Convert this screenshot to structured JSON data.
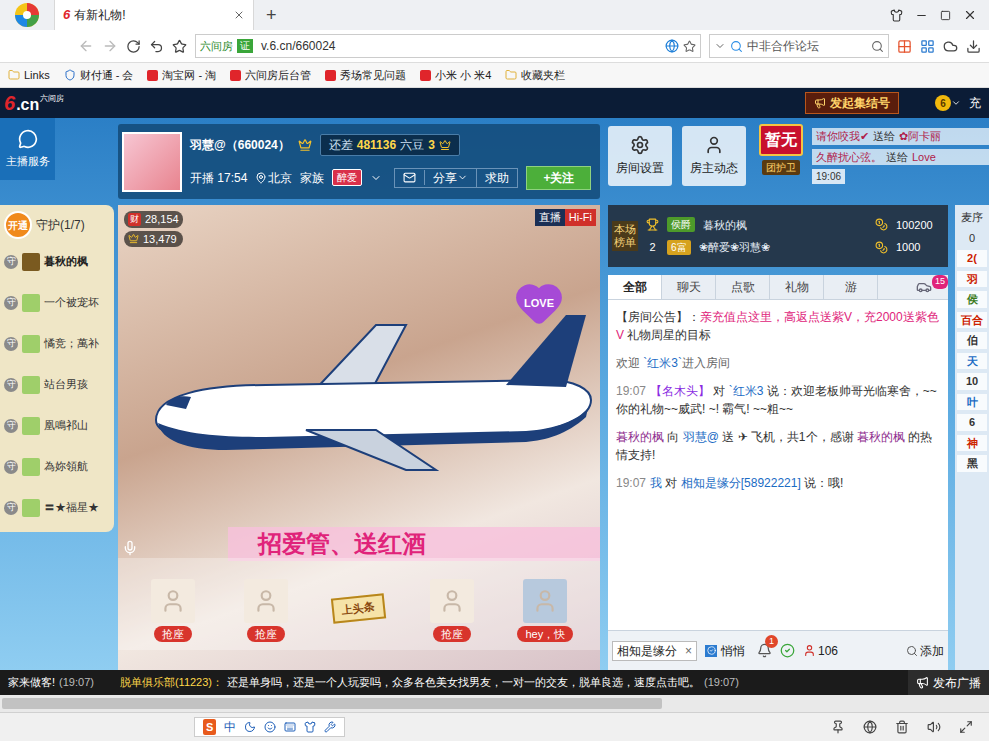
{
  "browser": {
    "tab_title": "有新礼物!",
    "new_tab": "+",
    "site_badge": "六间房",
    "cert": "证",
    "url": "v.6.cn/660024",
    "search_placeholder": "中非合作论坛"
  },
  "bookmarks": [
    "Links",
    "财付通 - 会",
    "淘宝网 - 淘",
    "六间房后台管",
    "秀场常见问题",
    "小米 小 米4",
    "收藏夹栏"
  ],
  "site_header": {
    "logo_mark": "6",
    "logo_text": ".cn",
    "logo_sub": "六间房",
    "rally_button": "发起集结号",
    "coin": "6",
    "recharge": "充"
  },
  "host_service": "主播服务",
  "host": {
    "name": "羽慧@（660024）",
    "need_label": "还差",
    "need_value": "481136",
    "need_unit": "六豆",
    "level": "3",
    "live_label": "开播 17:54",
    "city": "北京",
    "family_label": "家族",
    "family": "醉爱",
    "share": "分享",
    "help": "求助",
    "follow": "+关注"
  },
  "room_buttons": [
    {
      "label": "房间设置"
    },
    {
      "label": "房主动态"
    }
  ],
  "guard": {
    "empty": "暂无",
    "label": "团护卫"
  },
  "feed": {
    "time": "19:06",
    "items": [
      {
        "sender": "请你咬我✔",
        "action": "送给",
        "receiver": "✿阿卡丽"
      },
      {
        "sender": "久醉扰心弦。",
        "action": "送给",
        "receiver": "Love"
      }
    ]
  },
  "guardians": {
    "open": "开通",
    "title": "守护(1/7)",
    "badge": "守",
    "items": [
      {
        "name": "暮秋的枫",
        "selected": true
      },
      {
        "name": "一个被宠坏",
        "selected": false
      },
      {
        "name": "憰竞；萬补",
        "selected": false
      },
      {
        "name": "站台男孩",
        "selected": false
      },
      {
        "name": "凰鳴祁山",
        "selected": false
      },
      {
        "name": "為妳領航",
        "selected": false
      },
      {
        "name": "〓★福星★",
        "selected": false
      }
    ]
  },
  "video": {
    "wealth_icon": "财",
    "wealth": "28,154",
    "fans": "13,479",
    "live_tag": "直播",
    "hifi": "Hi-Fi",
    "love": "LOVE",
    "banner": "招爱管、送红酒",
    "seats": [
      {
        "label": "抢座",
        "kind": "seat"
      },
      {
        "label": "抢座",
        "kind": "seat"
      },
      {
        "label": "上头条",
        "kind": "headline"
      },
      {
        "label": "抢座",
        "kind": "seat"
      },
      {
        "label": "hey，快",
        "kind": "taken"
      }
    ]
  },
  "ranking": {
    "title": "本场榜单",
    "rows": [
      {
        "rank": "1",
        "kind": "trophy",
        "badge": "侯爵",
        "name": "暮秋的枫",
        "score": "100200"
      },
      {
        "rank": "2",
        "kind": "number",
        "badge": "6富",
        "name": "❀醉爱❀羽慧❀",
        "score": "1000"
      }
    ]
  },
  "chat": {
    "tabs": [
      {
        "label": "全部",
        "selected": true
      },
      {
        "label": "聊天",
        "selected": false
      },
      {
        "label": "点歌",
        "selected": false
      },
      {
        "label": "礼物",
        "selected": false
      },
      {
        "label": "游",
        "selected": false
      }
    ],
    "car_badge": "15",
    "messages": [
      {
        "time": "",
        "parts": [
          {
            "text": "【房间公告】：",
            "color": "#333333"
          },
          {
            "text": "亲充值点这里，高返点",
            "color": "#e0237a"
          },
          {
            "text": "送紫V，充2000送紫色V",
            "color": "#e0237a"
          },
          {
            "text": " 礼物周星的目标",
            "color": "#333333"
          }
        ]
      },
      {
        "time": "",
        "parts": [
          {
            "text": "欢迎 ",
            "color": "#666666"
          },
          {
            "text": "`红米3`",
            "color": "#1a6bc4"
          },
          {
            "text": "进入房间",
            "color": "#666666"
          }
        ]
      },
      {
        "time": "19:07",
        "parts": [
          {
            "text": "【名木头】",
            "color": "#8a2be2"
          },
          {
            "text": " 对 ",
            "color": "#333333"
          },
          {
            "text": "`红米3",
            "color": "#1a6bc4"
          },
          {
            "text": " 说：欢迎老板帅哥光临寒舍，~~你的礼物~~威武! ~! 霸气! ~~粗~~",
            "color": "#333333"
          }
        ]
      },
      {
        "time": "",
        "parts": [
          {
            "text": "暮秋的枫",
            "color": "#8e2d8e"
          },
          {
            "text": " 向 ",
            "color": "#333333"
          },
          {
            "text": "羽慧@",
            "color": "#1a6bc4"
          },
          {
            "text": " 送 ✈ 飞机，共1个，感谢 ",
            "color": "#333333"
          },
          {
            "text": "暮秋的枫",
            "color": "#8e2d8e"
          },
          {
            "text": " 的热情支持!",
            "color": "#333333"
          }
        ]
      },
      {
        "time": "19:07",
        "parts": [
          {
            "text": "我",
            "color": "#1a6bc4"
          },
          {
            "text": " 对 ",
            "color": "#333333"
          },
          {
            "text": "相知是缘分[58922221]",
            "color": "#1a6bc4"
          },
          {
            "text": " 说：哦!",
            "color": "#333333"
          }
        ]
      }
    ]
  },
  "input": {
    "target": "相知是缘分",
    "close": "×",
    "whisper": {
      "label": "悄悄",
      "checked": true
    },
    "notice_badge": "1",
    "viewers": "106",
    "add": "添加"
  },
  "right_column": {
    "title": "麦序",
    "count": "0",
    "chips": [
      {
        "text": "2(",
        "color": "#cc2200"
      },
      {
        "text": "羽",
        "color": "#cc2200"
      },
      {
        "text": "侯",
        "color": "#3a7a1a"
      },
      {
        "text": "百合",
        "color": "#cc2200"
      },
      {
        "text": "伯",
        "color": "#333333"
      },
      {
        "text": "天",
        "color": "#1a6bc4"
      },
      {
        "text": "10",
        "color": "#333333"
      },
      {
        "text": "叶",
        "color": "#1a6bc4"
      },
      {
        "text": "6",
        "color": "#333333"
      },
      {
        "text": "神",
        "color": "#cc2200"
      },
      {
        "text": "黑",
        "color": "#333333"
      }
    ]
  },
  "bottom_ticker": {
    "lead": "家来做客!",
    "lead_time": "(19:07)",
    "sender": "脱单俱乐部(11223)：",
    "message": "还是单身吗，还是一个人玩耍吗，众多各色美女找男友，一对一的交友，脱单良选，速度点击吧。",
    "time": "(19:07)",
    "broadcast": "发布广播"
  },
  "ime": {
    "logo": "S",
    "mode": "中"
  }
}
